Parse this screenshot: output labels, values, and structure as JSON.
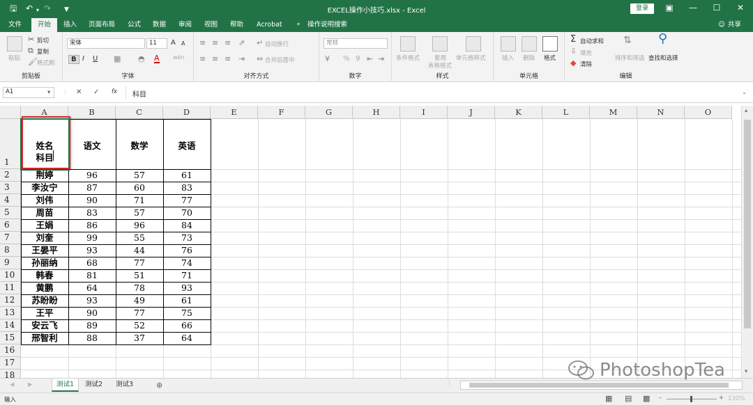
{
  "window": {
    "title": "EXCEL操作小技巧.xlsx  -  Excel",
    "login_label": "登录"
  },
  "tabs": [
    "文件",
    "开始",
    "插入",
    "页面布局",
    "公式",
    "数据",
    "审阅",
    "视图",
    "帮助",
    "Acrobat",
    "操作说明搜索",
    "共享"
  ],
  "ribbon": {
    "clipboard": {
      "paste": "粘贴",
      "cut": "剪切",
      "copy": "复制",
      "format_painter": "格式刷",
      "label": "剪贴板"
    },
    "font": {
      "name": "宋体",
      "size": "11",
      "bold": "B",
      "italic": "I",
      "underline": "U",
      "grow": "A",
      "shrink": "A",
      "wen": "wén",
      "label": "字体"
    },
    "alignment": {
      "wrap": "自动换行",
      "merge": "合并后居中",
      "label": "对齐方式"
    },
    "number": {
      "format": "常规",
      "percent": "%",
      "comma": "9",
      "label": "数字"
    },
    "styles": {
      "conditional": "条件格式",
      "table1": "套用",
      "table2": "表格格式",
      "cell_styles": "单元格样式",
      "label": "样式"
    },
    "cells": {
      "insert": "插入",
      "delete": "删除",
      "format": "格式",
      "label": "单元格"
    },
    "editing": {
      "autosum": "自动求和",
      "fill": "填充",
      "clear": "清除",
      "sort": "排序和筛选",
      "find": "查找和选择",
      "label": "编辑"
    }
  },
  "formula_bar": {
    "name_box": "A1",
    "fx": "fx",
    "value": "科目"
  },
  "sheet": {
    "columns": [
      "A",
      "B",
      "C",
      "D",
      "E",
      "F",
      "G",
      "H",
      "I",
      "J",
      "K",
      "L",
      "M",
      "N",
      "O"
    ],
    "row_numbers": [
      "1",
      "2",
      "3",
      "4",
      "5",
      "6",
      "7",
      "8",
      "9",
      "10",
      "11",
      "12",
      "13",
      "14",
      "15",
      "16",
      "17",
      "18"
    ],
    "header": {
      "a1_line1": "姓名",
      "a1_line2": "科目",
      "b": "语文",
      "c": "数学",
      "d": "英语"
    },
    "rows": [
      {
        "name": "荆婷",
        "b": "96",
        "c": "57",
        "d": "61"
      },
      {
        "name": "李汝宁",
        "b": "87",
        "c": "60",
        "d": "83"
      },
      {
        "name": "刘伟",
        "b": "90",
        "c": "71",
        "d": "77"
      },
      {
        "name": "周苗",
        "b": "83",
        "c": "57",
        "d": "70"
      },
      {
        "name": "王娟",
        "b": "86",
        "c": "96",
        "d": "84"
      },
      {
        "name": "刘奎",
        "b": "99",
        "c": "55",
        "d": "73"
      },
      {
        "name": "王晏平",
        "b": "93",
        "c": "44",
        "d": "76"
      },
      {
        "name": "孙丽纳",
        "b": "68",
        "c": "77",
        "d": "74"
      },
      {
        "name": "韩春",
        "b": "81",
        "c": "51",
        "d": "71"
      },
      {
        "name": "黄鹏",
        "b": "64",
        "c": "78",
        "d": "93"
      },
      {
        "name": "苏盼盼",
        "b": "93",
        "c": "49",
        "d": "61"
      },
      {
        "name": "王平",
        "b": "90",
        "c": "77",
        "d": "75"
      },
      {
        "name": "安云飞",
        "b": "89",
        "c": "52",
        "d": "66"
      },
      {
        "name": "邢智利",
        "b": "88",
        "c": "37",
        "d": "64"
      }
    ]
  },
  "sheet_tabs": [
    "测试1",
    "测试2",
    "测试3"
  ],
  "status": {
    "mode": "输入",
    "zoom": "130%"
  },
  "watermark": "PhotoshopTea",
  "colors": {
    "excel_green": "#217346",
    "highlight_red": "#d0282a"
  }
}
